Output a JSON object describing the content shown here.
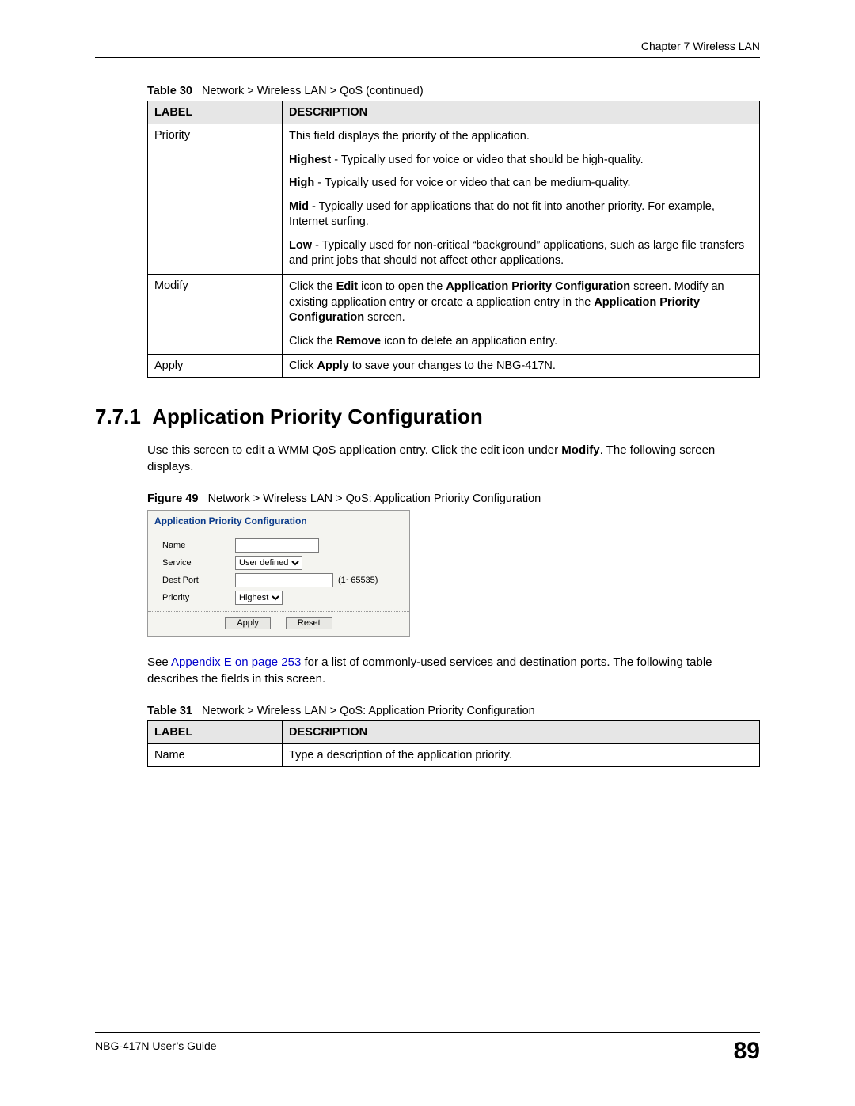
{
  "chapter_header": "Chapter 7 Wireless LAN",
  "table30": {
    "caption_num": "Table 30",
    "caption_text": "Network > Wireless LAN > QoS (continued)",
    "head_label": "LABEL",
    "head_desc": "DESCRIPTION",
    "rows": {
      "priority": {
        "label": "Priority",
        "intro": "This field displays the priority of the application.",
        "hi_b": "Highest",
        "hi_t": " - Typically used for voice or video that should be high-quality.",
        "h_b": "High",
        "h_t": " - Typically used for voice or video that can be medium-quality.",
        "m_b": "Mid",
        "m_t": " - Typically used for applications that do not fit into another priority. For example, Internet surfing.",
        "l_b": "Low",
        "l_t": " - Typically used for non-critical “background” applications, such as large file transfers and print jobs that should not affect other applications."
      },
      "modify": {
        "label": "Modify",
        "p1a": "Click the ",
        "p1b1": "Edit",
        "p1c": " icon to open the ",
        "p1b2": "Application Priority Configuration",
        "p1d": " screen. Modify an existing application entry or create a application entry in the ",
        "p1b3": "Application Priority Configuration",
        "p1e": " screen.",
        "p2a": "Click the ",
        "p2b": "Remove",
        "p2c": " icon to delete an application entry."
      },
      "apply": {
        "label": "Apply",
        "a": "Click ",
        "b": "Apply",
        "c": " to save your changes to the NBG-417N."
      }
    }
  },
  "section": {
    "number": "7.7.1",
    "title": "Application Priority Configuration"
  },
  "body1a": "Use this screen to edit a WMM QoS application entry. Click the edit icon under ",
  "body1b": "Modify",
  "body1c": ". The following screen displays.",
  "figure49": {
    "caption_num": "Figure 49",
    "caption_text": "Network > Wireless LAN > QoS: Application Priority Configuration",
    "dialog_title": "Application Priority Configuration",
    "name_label": "Name",
    "service_label": "Service",
    "service_value": "User defined",
    "destport_label": "Dest Port",
    "destport_hint": "(1~65535)",
    "priority_label": "Priority",
    "priority_value": "Highest",
    "apply_btn": "Apply",
    "reset_btn": "Reset"
  },
  "body2a": "See ",
  "body2link": "Appendix E on page 253",
  "body2b": " for a list of commonly-used services and destination ports. The following table describes the fields in this screen.",
  "table31": {
    "caption_num": "Table 31",
    "caption_text": "Network > Wireless LAN > QoS: Application Priority Configuration",
    "head_label": "LABEL",
    "head_desc": "DESCRIPTION",
    "rows": {
      "name": {
        "label": "Name",
        "desc": "Type a description of the application priority."
      }
    }
  },
  "footer": {
    "guide": "NBG-417N User’s Guide",
    "page": "89"
  }
}
